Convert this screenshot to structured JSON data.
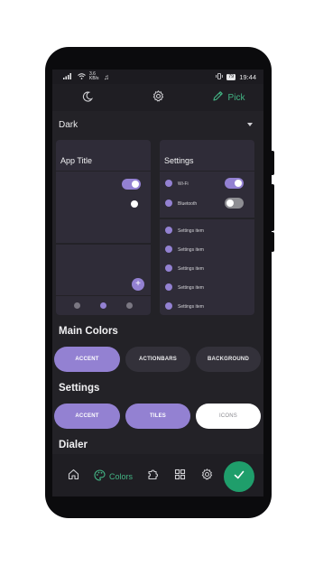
{
  "status_bar": {
    "left": "3.6 KB/s",
    "time": "19:44",
    "battery": "79"
  },
  "top_bar": {
    "pick_label": "Pick",
    "icons": [
      "moon-icon",
      "gear-icon",
      "pencil-icon"
    ]
  },
  "theme_dropdown": {
    "value": "Dark"
  },
  "preview_app": {
    "title": "App Title",
    "toggles": [
      "on",
      "off"
    ]
  },
  "preview_settings": {
    "title": "Settings",
    "toggles": [
      {
        "label": "Wi-Fi",
        "state": "on"
      },
      {
        "label": "Bluetooth",
        "state": "off"
      }
    ],
    "items": [
      "Settings item",
      "Settings item",
      "Settings item",
      "Settings item",
      "Settings item"
    ]
  },
  "main_colors": {
    "title": "Main Colors",
    "buttons": [
      "ACCENT",
      "ACTIONBARS",
      "BACKGROUND"
    ]
  },
  "settings_section": {
    "title": "Settings",
    "buttons": [
      "ACCENT",
      "TILES",
      "ICONS"
    ]
  },
  "dialer_section": {
    "title": "Dialer"
  },
  "bottom_nav": {
    "active_label": "Colors",
    "icons": [
      "home-icon",
      "palette-icon",
      "puzzle-icon",
      "widgets-icon",
      "gear-icon",
      "check-icon"
    ]
  },
  "colors": {
    "accent": "#9381d2",
    "green": "#43b484",
    "fab": "#1f9e6b",
    "background": "#232227",
    "card": "#2f2c38"
  }
}
